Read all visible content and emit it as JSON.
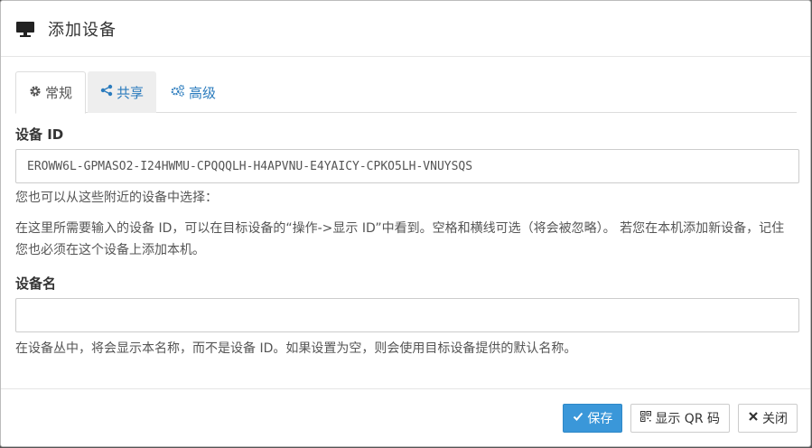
{
  "dialog": {
    "title": "添加设备",
    "icon": "monitor-icon"
  },
  "tabs": [
    {
      "label": "常规",
      "icon": "gear-icon",
      "active": true
    },
    {
      "label": "共享",
      "icon": "share-icon",
      "active": false
    },
    {
      "label": "高级",
      "icon": "cogs-icon",
      "active": false
    }
  ],
  "device_id": {
    "label": "设备 ID",
    "value": "EROWW6L-GPMASO2-I24HWMU-CPQQQLH-H4APVNU-E4YAICY-CPKO5LH-VNUYSQS",
    "nearby_hint": "您也可以从这些附近的设备中选择：",
    "help": "在这里所需要输入的设备 ID，可以在目标设备的“操作->显示 ID”中看到。空格和横线可选（将会被忽略）。 若您在本机添加新设备，记住您也必须在这个设备上添加本机。"
  },
  "device_name": {
    "label": "设备名",
    "value": "",
    "help": "在设备丛中，将会显示本名称，而不是设备 ID。如果设置为空，则会使用目标设备提供的默认名称。"
  },
  "footer": {
    "save_label": "保存",
    "qr_label": "显示 QR 码",
    "close_label": "关闭"
  },
  "colors": {
    "primary": "#3a97d9",
    "link": "#2a7bbd"
  }
}
